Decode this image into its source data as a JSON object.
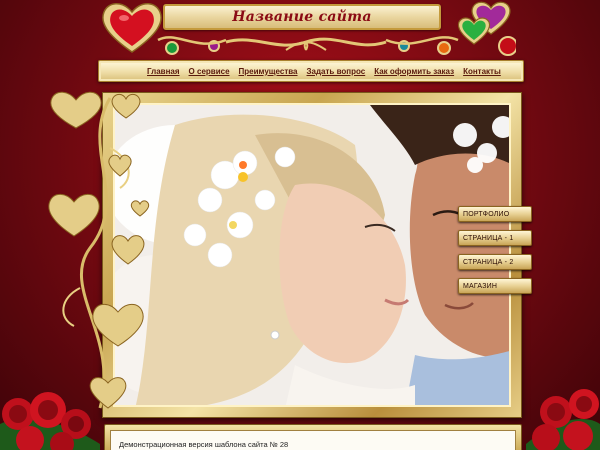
{
  "site_title": "Название сайта",
  "nav": {
    "items": [
      "Главная",
      "О сервисе",
      "Преимущества",
      "Задать вопрос",
      "Как оформить заказ",
      "Контакты"
    ]
  },
  "side_menu": {
    "items": [
      "ПОРТФОЛИО",
      "СТРАНИЦА - 1",
      "СТРАНИЦА - 2",
      "МАГАЗИН"
    ]
  },
  "footer_text": "Демонстрационная версия шаблона сайта № 28",
  "colors": {
    "background": "#8a0a12",
    "gold": "#c9a550",
    "nav_text": "#5a1a0c",
    "title_text": "#8a0a14"
  }
}
